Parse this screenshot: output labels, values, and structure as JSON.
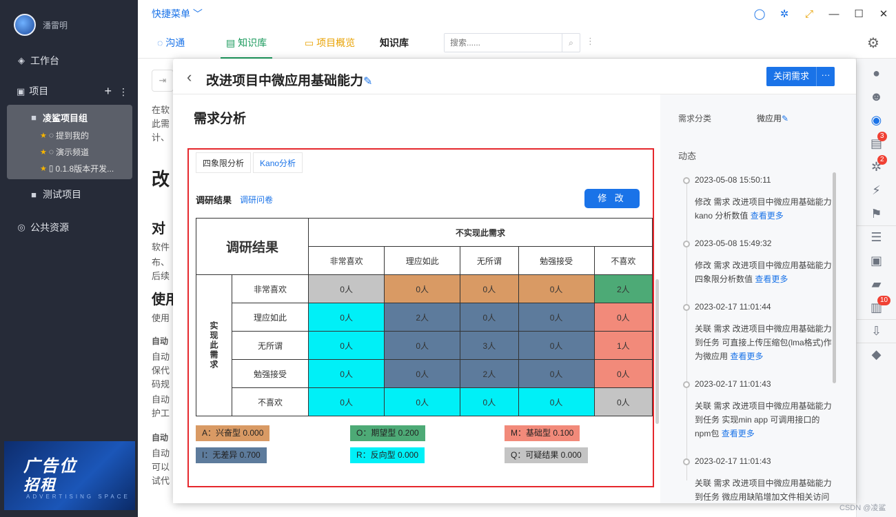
{
  "sidebar": {
    "username": "潘雷明",
    "nav": {
      "workbench": "工作台",
      "project": "项目",
      "test_project": "测试项目",
      "public": "公共资源"
    },
    "group": {
      "title": "凌鲨项目组",
      "items": [
        "提到我的",
        "演示频道",
        "0.1.8版本开发..."
      ]
    },
    "ad": {
      "line1": "广告位",
      "line2": "招租",
      "line3": "ADVERTISING SPACE"
    }
  },
  "topbar": {
    "quick_menu": "快捷菜单"
  },
  "tabs": {
    "comm": "沟通",
    "kb": "知识库",
    "overview": "项目概览",
    "current": "知识库",
    "search_placeholder": "搜索......"
  },
  "rail_badges": {
    "docs": "3",
    "bugs": "2",
    "tests": "10"
  },
  "background": {
    "lines": [
      "在软",
      "此需",
      "计、",
      "改",
      "对",
      "软件",
      "布、",
      "后续",
      "使用",
      "使用",
      "自动",
      "自动",
      "保代",
      "码规",
      "自动",
      "护工",
      "自动",
      "自动",
      "可以",
      "试代"
    ]
  },
  "panel": {
    "title": "改进项目中微应用基础能力",
    "close_button": "关闭需求",
    "more_button": "···",
    "section_title": "需求分析",
    "analysis_tabs": [
      "四象限分析",
      "Kano分析"
    ],
    "result_label": "调研结果",
    "survey_link": "调研问卷",
    "edit_button": "修 改",
    "table": {
      "corner": "调研结果",
      "top_header": "不实现此需求",
      "side_header": "实现此需求",
      "col_headers": [
        "非常喜欢",
        "理应如此",
        "无所谓",
        "勉强接受",
        "不喜欢"
      ],
      "row_headers": [
        "非常喜欢",
        "理应如此",
        "无所谓",
        "勉强接受",
        "不喜欢"
      ],
      "cells": [
        [
          "0人",
          "0人",
          "0人",
          "0人",
          "2人"
        ],
        [
          "0人",
          "2人",
          "0人",
          "0人",
          "0人"
        ],
        [
          "0人",
          "0人",
          "3人",
          "0人",
          "1人"
        ],
        [
          "0人",
          "0人",
          "2人",
          "0人",
          "0人"
        ],
        [
          "0人",
          "0人",
          "0人",
          "0人",
          "0人"
        ]
      ]
    },
    "legend": [
      {
        "label": "A：兴奋型   0.000",
        "color": "#d99a64"
      },
      {
        "label": "O：期望型   0.200",
        "color": "#4daa76"
      },
      {
        "label": "M：基础型   0.100",
        "color": "#f28a7a"
      },
      {
        "label": "I：无差异   0.700",
        "color": "#5d7b9c"
      },
      {
        "label": "R：反向型   0.000",
        "color": "#00f0f7"
      },
      {
        "label": "Q：可疑结果   0.000",
        "color": "#c4c4c4"
      }
    ]
  },
  "right": {
    "category_label": "需求分类",
    "category_value": "微应用",
    "activity_label": "动态",
    "events": [
      {
        "time": "2023-05-08 15:50:11",
        "text": "修改 需求 改进项目中微应用基础能力kano 分析数值",
        "link": "查看更多"
      },
      {
        "time": "2023-05-08 15:49:32",
        "text": "修改 需求 改进项目中微应用基础能力四象限分析数值",
        "link": "查看更多"
      },
      {
        "time": "2023-02-17 11:01:44",
        "text": "关联 需求 改进项目中微应用基础能力到任务 可直接上传压缩包(lma格式)作为微应用",
        "link": "查看更多"
      },
      {
        "time": "2023-02-17 11:01:43",
        "text": "关联 需求 改进项目中微应用基础能力到任务 实现min app 可调用接口的npm包",
        "link": "查看更多"
      },
      {
        "time": "2023-02-17 11:01:43",
        "text": "关联 需求 改进项目中微应用基础能力到任务 微应用缺陷增加文件相关访问",
        "link": ""
      }
    ]
  },
  "watermark": "CSDN @凌鲨",
  "colors": {
    "excite": "#d99a64",
    "expect": "#4daa76",
    "basic": "#f28a7a",
    "indiff": "#5d7b9c",
    "reverse": "#00f0f7",
    "question": "#c4c4c4"
  }
}
